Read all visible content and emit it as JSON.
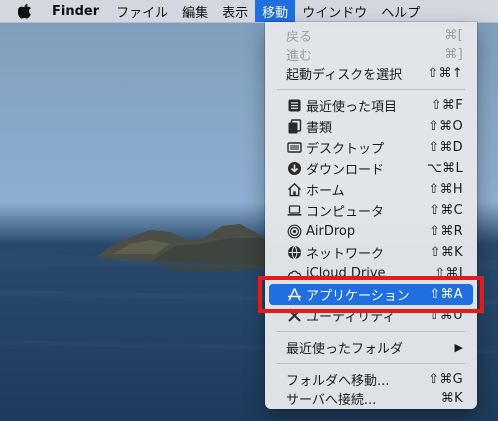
{
  "menubar": {
    "apple_icon": "apple-logo-icon",
    "app_name": "Finder",
    "items": [
      "ファイル",
      "編集",
      "表示",
      "移動",
      "ウインドウ",
      "ヘルプ"
    ],
    "active_item": "移動"
  },
  "menu": {
    "items": [
      {
        "label": "戻る",
        "shortcut": "⌘[",
        "disabled": true
      },
      {
        "label": "進む",
        "shortcut": "⌘]",
        "disabled": true
      },
      {
        "label": "起動ディスクを選択",
        "shortcut": "⇧⌘↑"
      },
      {
        "label": "最近使った項目",
        "shortcut": "⇧⌘F",
        "icon": "recents-icon"
      },
      {
        "label": "書類",
        "shortcut": "⇧⌘O",
        "icon": "documents-icon"
      },
      {
        "label": "デスクトップ",
        "shortcut": "⇧⌘D",
        "icon": "desktop-icon"
      },
      {
        "label": "ダウンロード",
        "shortcut": "⌥⌘L",
        "icon": "downloads-icon"
      },
      {
        "label": "ホーム",
        "shortcut": "⇧⌘H",
        "icon": "home-icon"
      },
      {
        "label": "コンピュータ",
        "shortcut": "⇧⌘C",
        "icon": "computer-icon"
      },
      {
        "label": "AirDrop",
        "shortcut": "⇧⌘R",
        "icon": "airdrop-icon"
      },
      {
        "label": "ネットワーク",
        "shortcut": "⇧⌘K",
        "icon": "network-icon"
      },
      {
        "label": "iCloud Drive",
        "shortcut": "⇧⌘I",
        "icon": "icloud-icon"
      },
      {
        "label": "アプリケーション",
        "shortcut": "⇧⌘A",
        "icon": "applications-icon",
        "highlighted": true
      },
      {
        "label": "ユーティリティ",
        "shortcut": "⇧⌘U",
        "icon": "utilities-icon"
      },
      {
        "label": "最近使ったフォルダ",
        "submenu": true
      },
      {
        "label": "フォルダへ移動...",
        "shortcut": "⇧⌘G"
      },
      {
        "label": "サーバへ接続...",
        "shortcut": "⌘K"
      }
    ]
  },
  "colors": {
    "highlight": "#1f6fe0",
    "annotation_box": "#e51b1b"
  }
}
